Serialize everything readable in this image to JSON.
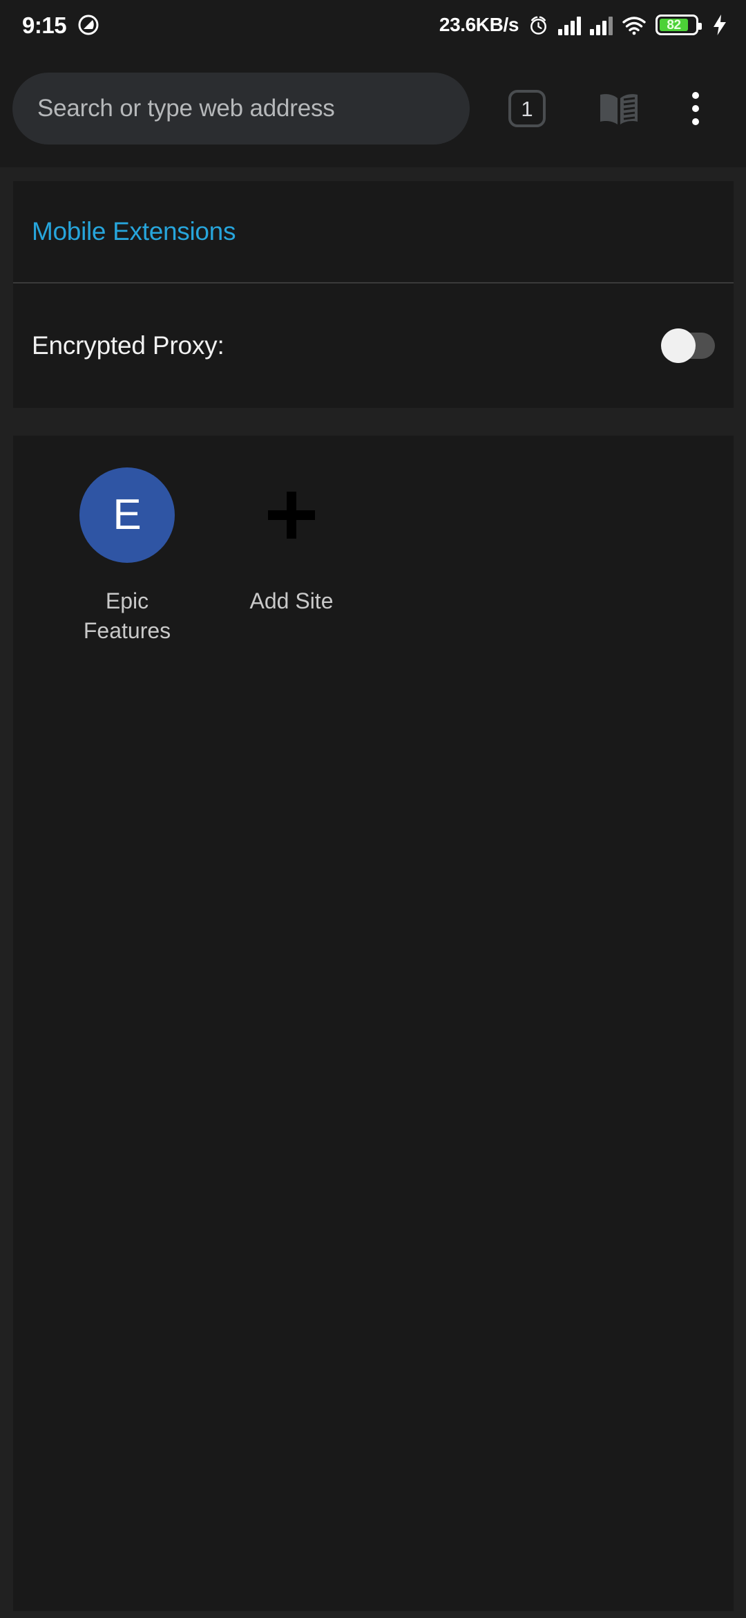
{
  "status_bar": {
    "time": "9:15",
    "dnd_icon": "do-not-disturb-icon",
    "network_speed": "23.6KB/s",
    "alarm_icon": "alarm-clock-icon",
    "signal_icon": "cellular-signal-icon",
    "signal_icon_2": "cellular-signal-secondary-icon",
    "wifi_icon": "wifi-icon",
    "battery_level": "82",
    "battery_icon": "battery-icon",
    "charging_icon": "charging-bolt-icon",
    "battery_color": "#4cd137"
  },
  "toolbar": {
    "url_placeholder": "Search or type web address",
    "url_value": "",
    "tab_count": "1",
    "bookmarks_icon": "book-icon",
    "menu_icon": "overflow-menu-icon"
  },
  "extensions_card": {
    "header_link": "Mobile Extensions",
    "link_color": "#27a5db",
    "setting_label": "Encrypted Proxy:",
    "toggle_state": "off"
  },
  "sites_card": {
    "tiles": [
      {
        "type": "site",
        "initial": "E",
        "label": "Epic\nFeatures",
        "label_line1": "Epic",
        "label_line2": "Features",
        "badge_color": "#2f55a4"
      },
      {
        "type": "add",
        "icon": "plus-icon",
        "label": "Add Site"
      }
    ]
  }
}
